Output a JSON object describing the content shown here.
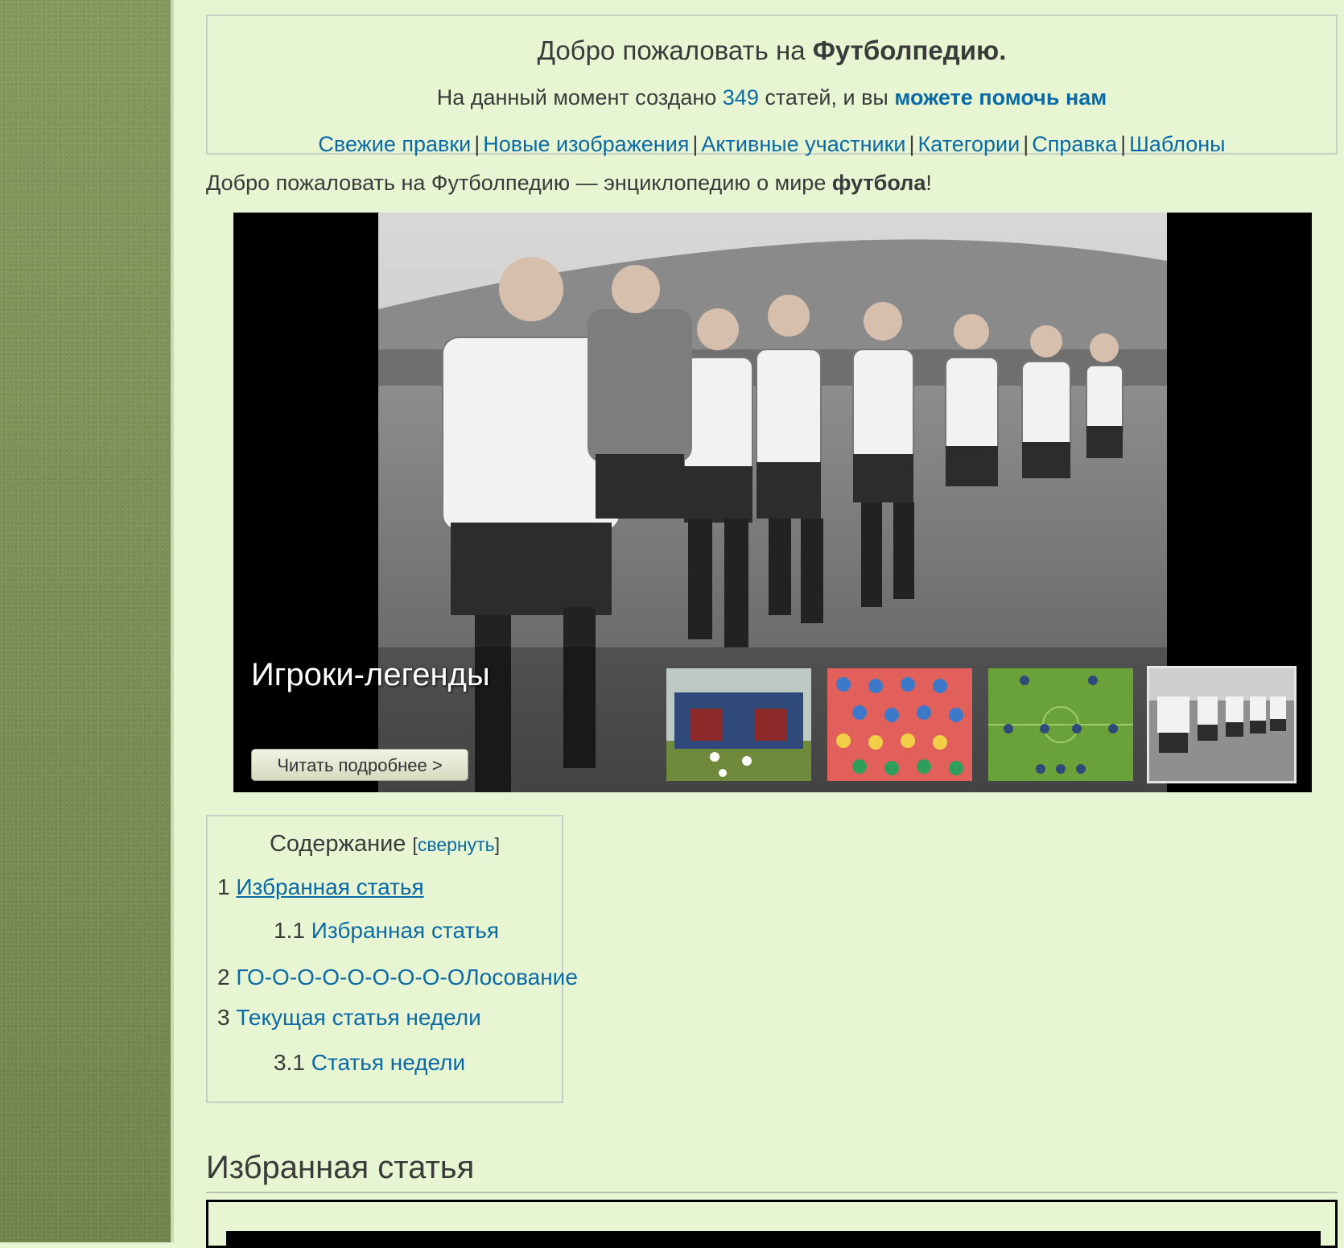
{
  "welcome": {
    "title_prefix": "Добро пожаловать на ",
    "title_bold": "Футболпедию.",
    "stats_prefix": "На данный момент создано ",
    "stats_count": "349",
    "stats_middle": " статей, и вы ",
    "stats_help": "можете помочь нам",
    "links": [
      "Свежие правки",
      "Новые изображения",
      "Активные участники",
      "Категории",
      "Справка",
      "Шаблоны"
    ],
    "separator": "|"
  },
  "intro": {
    "text": "Добро пожаловать на Футболпедию — энциклопедию о мире ",
    "bold": "футбола",
    "end": "!"
  },
  "slider": {
    "title": "Игроки-легенды",
    "read_more": "Читать подробнее >",
    "thumbnails": [
      "team-photo",
      "club-badges",
      "tactics-formation",
      "legends-photo"
    ],
    "active_index": 3
  },
  "toc": {
    "title": "Содержание",
    "toggle_open": "[",
    "toggle": "свернуть",
    "toggle_close": "]",
    "items": [
      {
        "num": "1",
        "label": "Избранная статья"
      },
      {
        "num": "1.1",
        "label": "Избранная статья"
      },
      {
        "num": "2",
        "label": "ГО-О-О-О-О-О-О-О-ОЛосование"
      },
      {
        "num": "3",
        "label": "Текущая статья недели"
      },
      {
        "num": "3.1",
        "label": "Статья недели"
      }
    ]
  },
  "section": {
    "heading": "Избранная статья"
  },
  "colors": {
    "background": "#e8f5d2",
    "link": "#0a6aa8",
    "sidebar": "#7b8e58"
  }
}
